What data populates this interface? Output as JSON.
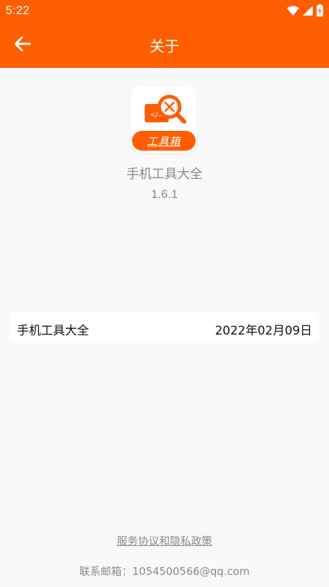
{
  "status_bar": {
    "time": "5:22"
  },
  "header": {
    "title": "关于"
  },
  "app": {
    "icon_banner_text": "工具箱",
    "name": "手机工具大全",
    "version": "1.6.1"
  },
  "info_card": {
    "left_text": "手机工具大全",
    "right_text": "2022年02月09日"
  },
  "footer": {
    "policy_link": "服务协议和隐私政策",
    "contact": "联系邮箱：1054500566@qq.com"
  },
  "colors": {
    "brand": "#ff5e00",
    "background": "#f9f9f9",
    "muted_text": "#8a8a8a"
  }
}
